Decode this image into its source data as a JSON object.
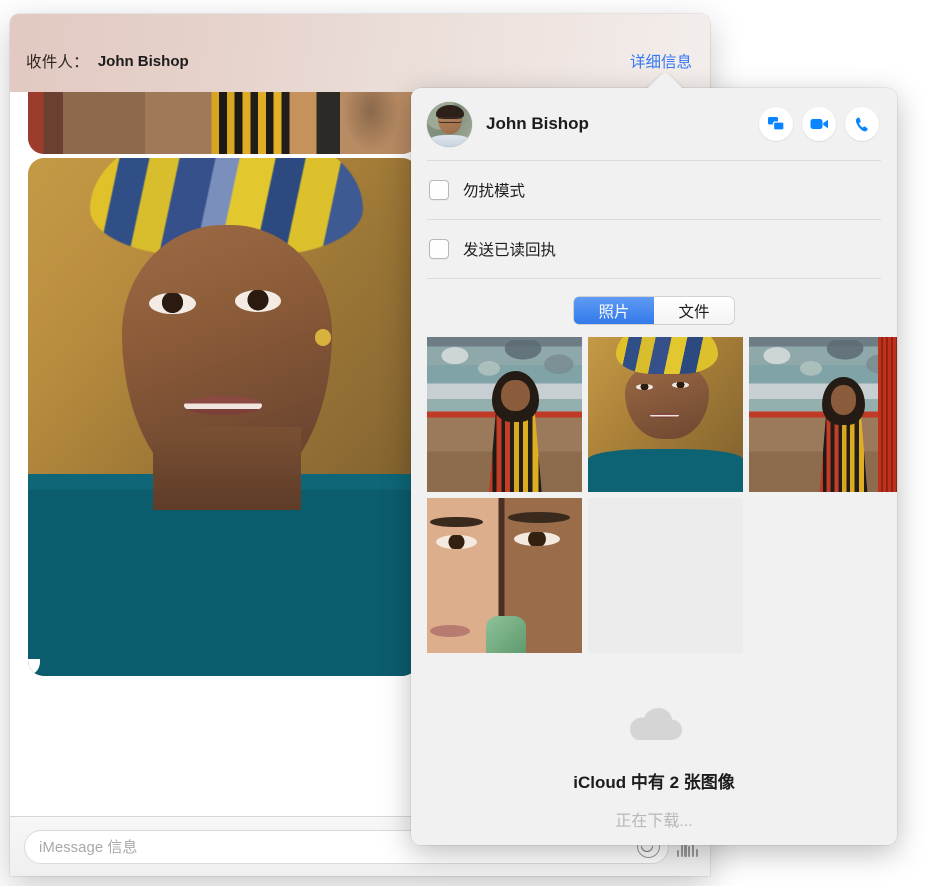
{
  "window": {
    "recipient_label": "收件人：",
    "recipient_name": "John Bishop",
    "details_link": "详细信息"
  },
  "composer": {
    "placeholder": "iMessage 信息",
    "value": "",
    "emoji_icon": "smiley-icon",
    "audio_icon": "audio-waveform-icon"
  },
  "popover": {
    "contact_name": "John Bishop",
    "avatar": "contact-avatar",
    "actions": [
      {
        "name": "screen-share-button",
        "icon": "screen-share-icon"
      },
      {
        "name": "video-call-button",
        "icon": "video-camera-icon"
      },
      {
        "name": "audio-call-button",
        "icon": "phone-icon"
      }
    ],
    "options": [
      {
        "label": "勿扰模式",
        "checked": false
      },
      {
        "label": "发送已读回执",
        "checked": false
      }
    ],
    "segments": [
      {
        "label": "照片",
        "selected": true
      },
      {
        "label": "文件",
        "selected": false
      }
    ],
    "attachments": [
      {
        "name": "photo-thumbnail-1",
        "alt": "woman-seated-against-peeling-wall"
      },
      {
        "name": "photo-thumbnail-2",
        "alt": "portrait-with-yellow-blue-headwrap"
      },
      {
        "name": "photo-thumbnail-3",
        "alt": "woman-seated-beside-red-railing"
      },
      {
        "name": "photo-thumbnail-4",
        "alt": "two-faces-close-up"
      },
      {
        "name": "photo-placeholder-5",
        "alt": "loading-placeholder"
      }
    ],
    "icloud": {
      "icon": "cloud-icon",
      "title": "iCloud 中有 2 张图像",
      "status": "正在下载..."
    }
  },
  "colors": {
    "accent_blue": "#3578f6",
    "segment_blue": "#3379ea",
    "popover_bg": "#f1f1f1",
    "placeholder_gray": "#a9a9a9",
    "status_gray": "#b8b8b8"
  }
}
